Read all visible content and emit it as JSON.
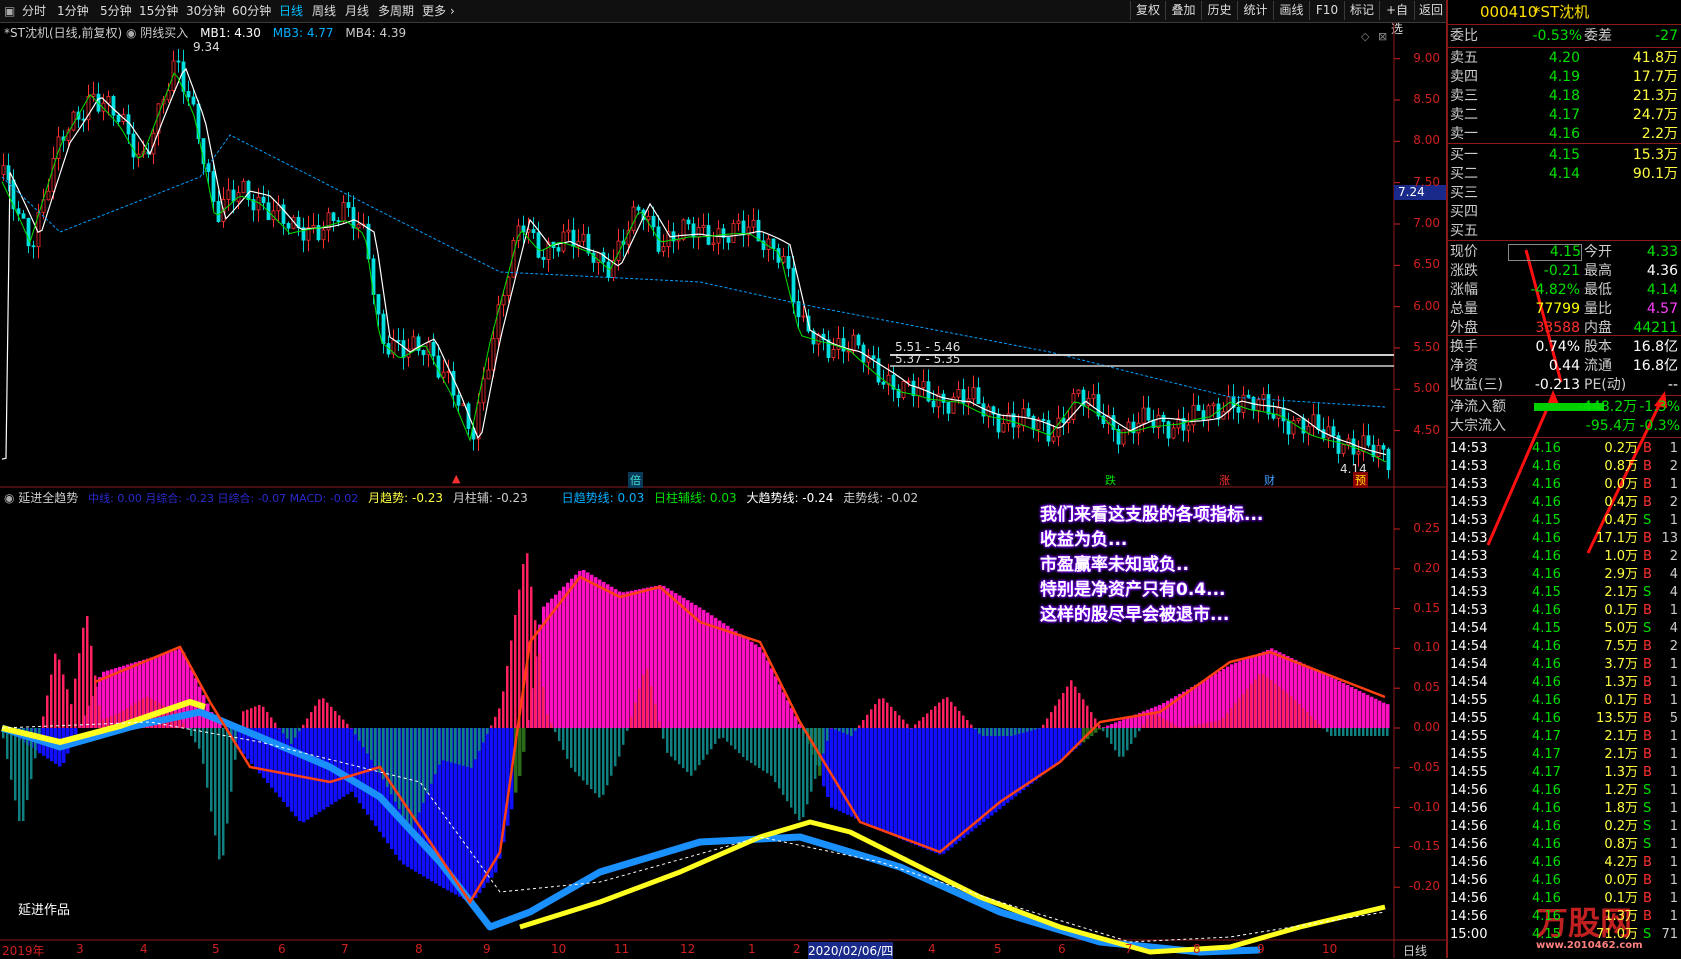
{
  "toolbar": {
    "left_items": [
      "分时",
      "1分钟",
      "5分钟",
      "15分钟",
      "30分钟",
      "日线",
      "周线",
      "月线",
      "多周期",
      "更多"
    ],
    "active": "日线",
    "right_items": [
      "复权",
      "叠加",
      "历史",
      "统计",
      "画线",
      "F10",
      "标记",
      "+自选",
      "返回"
    ]
  },
  "kline": {
    "title": "*ST沈机(日线,前复权)",
    "indicator_name": "阴线买入",
    "mb1_label": "MB1: 4.30",
    "mb3_label": "MB3: 4.77",
    "mb4_label": "MB4: 4.39",
    "y_ticks": [
      "9.00",
      "8.50",
      "8.00",
      "7.50",
      "7.00",
      "6.50",
      "6.00",
      "5.50",
      "5.00",
      "4.50"
    ],
    "price_tag": "7.24",
    "max_label": "9.34",
    "min_label": "4.14",
    "sr_label1": "5.51 - 5.46",
    "sr_label2": "5.37 - 5.35",
    "markers": [
      "倍",
      "跌",
      "涨",
      "财",
      "预"
    ]
  },
  "trend": {
    "name": "延进全趋势",
    "legend_hidden": "中线: 0.00  月综合: -0.23 日综合: -0.07 MACD: -0.02",
    "legend_items": [
      "月趋势: -0.23",
      "月柱辅: -0.23",
      "日趋势线: 0.03",
      "日柱辅线: 0.03",
      "大趋势线: -0.24",
      "走势线: -0.02"
    ],
    "y_ticks": [
      "0.25",
      "0.20",
      "0.15",
      "0.10",
      "0.05",
      "0.00",
      "-0.05",
      "-0.10",
      "-0.15",
      "-0.20"
    ],
    "author": "延进作品"
  },
  "dates": {
    "labels": [
      "2019年",
      "3",
      "4",
      "5",
      "6",
      "7",
      "8",
      "9",
      "10",
      "11",
      "12",
      "1",
      "2",
      "2020/02/06/四",
      "4",
      "5",
      "6",
      "7",
      "8",
      "9",
      "10"
    ],
    "period": "日线"
  },
  "annotation": [
    "我们来看这支股的各项指标...",
    "收益为负...",
    "市盈赢率未知或负..",
    "特别是净资产只有0.4...",
    "这样的股尽早会被退市..."
  ],
  "stock": {
    "code": "000410",
    "name": "*ST沈机"
  },
  "order_book": {
    "weibi_label": "委比",
    "weibi": "-0.53%",
    "weicha_label": "委差",
    "weicha": "-27",
    "sells": [
      {
        "label": "卖五",
        "price": "4.20",
        "vol": "41.8万"
      },
      {
        "label": "卖四",
        "price": "4.19",
        "vol": "17.7万"
      },
      {
        "label": "卖三",
        "price": "4.18",
        "vol": "21.3万"
      },
      {
        "label": "卖二",
        "price": "4.17",
        "vol": "24.7万"
      },
      {
        "label": "卖一",
        "price": "4.16",
        "vol": "2.2万"
      }
    ],
    "buys": [
      {
        "label": "买一",
        "price": "4.15",
        "vol": "15.3万"
      },
      {
        "label": "买二",
        "price": "4.14",
        "vol": "90.1万"
      },
      {
        "label": "买三",
        "price": "",
        "vol": ""
      },
      {
        "label": "买四",
        "price": "",
        "vol": ""
      },
      {
        "label": "买五",
        "price": "",
        "vol": ""
      }
    ]
  },
  "quote": [
    {
      "l1": "现价",
      "v1": "4.15",
      "l2": "今开",
      "v2": "4.33",
      "c1": "#00e000",
      "c2": "#00e000"
    },
    {
      "l1": "涨跌",
      "v1": "-0.21",
      "l2": "最高",
      "v2": "4.36",
      "c1": "#00e000",
      "c2": "#ffffff"
    },
    {
      "l1": "涨幅",
      "v1": "-4.82%",
      "l2": "最低",
      "v2": "4.14",
      "c1": "#00e000",
      "c2": "#00e000"
    },
    {
      "l1": "总量",
      "v1": "77799",
      "l2": "量比",
      "v2": "4.57",
      "c1": "#ffff00",
      "c2": "#ff40ff"
    },
    {
      "l1": "外盘",
      "v1": "33588",
      "l2": "内盘",
      "v2": "44211",
      "c1": "#ff3030",
      "c2": "#00e000"
    }
  ],
  "fundamentals": [
    {
      "l1": "换手",
      "v1": "0.74%",
      "l2": "股本",
      "v2": "16.8亿"
    },
    {
      "l1": "净资",
      "v1": "0.44",
      "l2": "流通",
      "v2": "16.8亿"
    },
    {
      "l1": "收益(三)",
      "v1": "-0.213",
      "l2": "PE(动)",
      "v2": "--"
    }
  ],
  "flows": [
    {
      "label": "净流入额",
      "value": "-448.2万",
      "pct": "-1.3%"
    },
    {
      "label": "大宗流入",
      "value": "-95.4万",
      "pct": "-0.3%"
    }
  ],
  "ticks": [
    {
      "t": "14:53",
      "p": "4.16",
      "v": "0.2万",
      "d": "B",
      "n": "1"
    },
    {
      "t": "14:53",
      "p": "4.16",
      "v": "0.8万",
      "d": "B",
      "n": "2"
    },
    {
      "t": "14:53",
      "p": "4.16",
      "v": "0.0万",
      "d": "B",
      "n": "1"
    },
    {
      "t": "14:53",
      "p": "4.16",
      "v": "0.4万",
      "d": "B",
      "n": "2"
    },
    {
      "t": "14:53",
      "p": "4.15",
      "v": "0.4万",
      "d": "S",
      "n": "1"
    },
    {
      "t": "14:53",
      "p": "4.16",
      "v": "17.1万",
      "d": "B",
      "n": "13"
    },
    {
      "t": "14:53",
      "p": "4.16",
      "v": "1.0万",
      "d": "B",
      "n": "2"
    },
    {
      "t": "14:53",
      "p": "4.16",
      "v": "2.9万",
      "d": "B",
      "n": "4"
    },
    {
      "t": "14:53",
      "p": "4.15",
      "v": "2.1万",
      "d": "S",
      "n": "4"
    },
    {
      "t": "14:53",
      "p": "4.16",
      "v": "0.1万",
      "d": "B",
      "n": "1"
    },
    {
      "t": "14:54",
      "p": "4.15",
      "v": "5.0万",
      "d": "S",
      "n": "4"
    },
    {
      "t": "14:54",
      "p": "4.16",
      "v": "7.5万",
      "d": "B",
      "n": "2"
    },
    {
      "t": "14:54",
      "p": "4.16",
      "v": "3.7万",
      "d": "B",
      "n": "1"
    },
    {
      "t": "14:54",
      "p": "4.16",
      "v": "1.3万",
      "d": "B",
      "n": "1"
    },
    {
      "t": "14:55",
      "p": "4.16",
      "v": "0.1万",
      "d": "B",
      "n": "1"
    },
    {
      "t": "14:55",
      "p": "4.16",
      "v": "13.5万",
      "d": "B",
      "n": "5"
    },
    {
      "t": "14:55",
      "p": "4.17",
      "v": "2.1万",
      "d": "B",
      "n": "1"
    },
    {
      "t": "14:55",
      "p": "4.17",
      "v": "2.1万",
      "d": "B",
      "n": "1"
    },
    {
      "t": "14:55",
      "p": "4.17",
      "v": "1.3万",
      "d": "B",
      "n": "1"
    },
    {
      "t": "14:56",
      "p": "4.16",
      "v": "1.2万",
      "d": "S",
      "n": "1"
    },
    {
      "t": "14:56",
      "p": "4.16",
      "v": "1.8万",
      "d": "S",
      "n": "1"
    },
    {
      "t": "14:56",
      "p": "4.16",
      "v": "0.2万",
      "d": "S",
      "n": "1"
    },
    {
      "t": "14:56",
      "p": "4.16",
      "v": "0.8万",
      "d": "S",
      "n": "1"
    },
    {
      "t": "14:56",
      "p": "4.16",
      "v": "4.2万",
      "d": "B",
      "n": "1"
    },
    {
      "t": "14:56",
      "p": "4.16",
      "v": "0.0万",
      "d": "B",
      "n": "1"
    },
    {
      "t": "14:56",
      "p": "4.16",
      "v": "0.1万",
      "d": "B",
      "n": "1"
    },
    {
      "t": "14:56",
      "p": "4.16",
      "v": "1.3万",
      "d": "B",
      "n": "1"
    },
    {
      "t": "15:00",
      "p": "4.15",
      "v": "71.0万",
      "d": "S",
      "n": "71"
    }
  ],
  "watermark": {
    "text": "万股网",
    "url": "www.2010462.com"
  },
  "colors": {
    "up": "#ff3030",
    "down": "#00e000",
    "axis": "#d02020",
    "accent": "#00c0ff"
  }
}
